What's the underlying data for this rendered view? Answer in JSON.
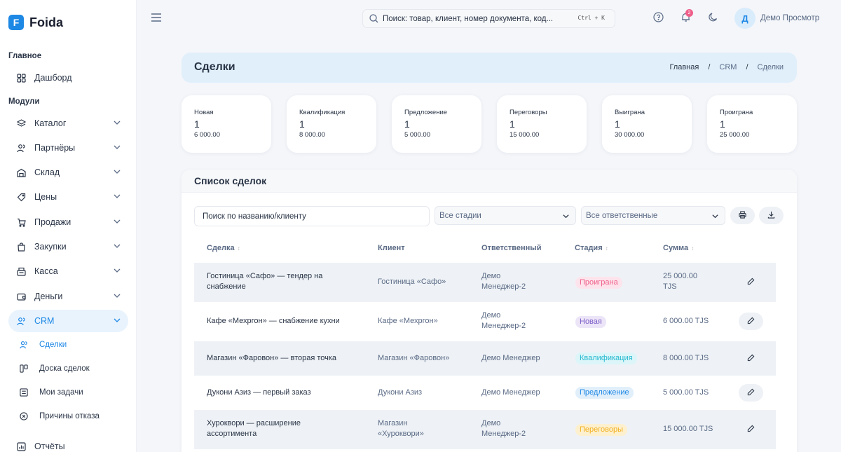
{
  "app": {
    "logo_letter": "F",
    "name": "Foida"
  },
  "sidebar": {
    "section_main": "Главное",
    "dashboard": "Дашборд",
    "section_modules": "Модули",
    "items": [
      {
        "label": "Каталог",
        "icon": "catalog-icon"
      },
      {
        "label": "Партнёры",
        "icon": "partners-icon"
      },
      {
        "label": "Склад",
        "icon": "warehouse-icon"
      },
      {
        "label": "Цены",
        "icon": "price-tag-icon"
      },
      {
        "label": "Продажи",
        "icon": "cart-icon"
      },
      {
        "label": "Закупки",
        "icon": "shopping-bag-icon"
      },
      {
        "label": "Касса",
        "icon": "cash-register-icon"
      },
      {
        "label": "Деньги",
        "icon": "wallet-icon"
      },
      {
        "label": "CRM",
        "icon": "users-icon"
      }
    ],
    "crm_sub": [
      {
        "label": "Сделки",
        "icon": "users-icon"
      },
      {
        "label": "Доска сделок",
        "icon": "kanban-icon"
      },
      {
        "label": "Мои задачи",
        "icon": "checklist-icon"
      },
      {
        "label": "Причины отказа",
        "icon": "x-circle-icon"
      }
    ],
    "reports": "Отчёты"
  },
  "topbar": {
    "search_placeholder": "Поиск: товар, клиент, номер документа, код...",
    "shortcut": "Ctrl + K",
    "notifications_count": "2",
    "avatar_letter": "Д",
    "user_name": "Демо Просмотр"
  },
  "page": {
    "title": "Сделки",
    "breadcrumbs": [
      "Главная",
      "CRM",
      "Сделки"
    ]
  },
  "stages": [
    {
      "label": "Новая",
      "count": "1",
      "sum": "6 000.00"
    },
    {
      "label": "Квалификация",
      "count": "1",
      "sum": "8 000.00"
    },
    {
      "label": "Предложение",
      "count": "1",
      "sum": "5 000.00"
    },
    {
      "label": "Переговоры",
      "count": "1",
      "sum": "15 000.00"
    },
    {
      "label": "Выиграна",
      "count": "1",
      "sum": "30 000.00"
    },
    {
      "label": "Проиграна",
      "count": "1",
      "sum": "25 000.00"
    }
  ],
  "list": {
    "title": "Список сделок",
    "search_placeholder": "Поиск по названию/клиенту",
    "stage_filter": "Все стадии",
    "owner_filter": "Все ответственные",
    "columns": [
      "Сделка",
      "Клиент",
      "Ответственный",
      "Стадия",
      "Сумма"
    ],
    "rows": [
      {
        "deal": [
          "Гостиница «Сафо» — тендер на",
          "снабжение"
        ],
        "client": [
          "Гостиница «Сафо»"
        ],
        "owner": [
          "Демо",
          "Менеджер-2"
        ],
        "stage": "Проиграна",
        "sum": [
          "25 000.00",
          "TJS"
        ]
      },
      {
        "deal": [
          "Кафе «Мехргон» — снабжение кухни"
        ],
        "client": [
          "Кафе «Мехргон»"
        ],
        "owner": [
          "Демо",
          "Менеджер-2"
        ],
        "stage": "Новая",
        "sum": [
          "6 000.00 TJS"
        ]
      },
      {
        "deal": [
          "Магазин «Фаровон» — вторая точка"
        ],
        "client": [
          "Магазин «Фаровон»"
        ],
        "owner": [
          "Демо Менеджер"
        ],
        "stage": "Квалификация",
        "sum": [
          "8 000.00 TJS"
        ]
      },
      {
        "deal": [
          "Дукони Азиз — первый заказ"
        ],
        "client": [
          "Дукони Азиз"
        ],
        "owner": [
          "Демо Менеджер"
        ],
        "stage": "Предложение",
        "sum": [
          "5 000.00 TJS"
        ]
      },
      {
        "deal": [
          "Хуроквори — расширение",
          "ассортимента"
        ],
        "client": [
          "Магазин",
          "«Хуроквори»"
        ],
        "owner": [
          "Демо",
          "Менеджер-2"
        ],
        "stage": "Переговоры",
        "sum": [
          "15 000.00 TJS"
        ]
      }
    ]
  },
  "colors": {
    "accent": "#1e88e5",
    "stage_lost": "#ef5f8a",
    "stage_new": "#7b5cc7",
    "stage_qualification": "#22b8cf",
    "stage_proposal": "#1e88e5",
    "stage_negotiation": "#f2b01e"
  }
}
